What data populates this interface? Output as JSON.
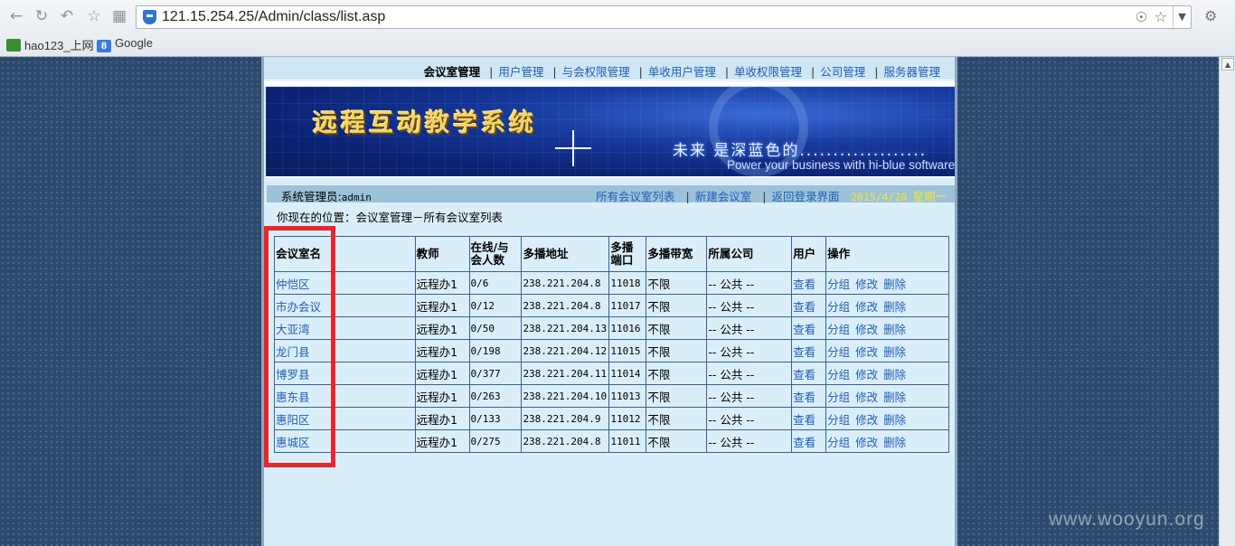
{
  "browser": {
    "url": "121.15.254.25/Admin/class/list.asp",
    "bookmarks": [
      "hao123_上网",
      "Google"
    ]
  },
  "topnav": {
    "items": [
      "会议室管理",
      "用户管理",
      "与会权限管理",
      "单收用户管理",
      "单收权限管理",
      "公司管理",
      "服务器管理"
    ]
  },
  "banner": {
    "title": "远程互动教学系统",
    "slogan_cn": "未来 是深蓝色的...................",
    "slogan_en": "Power your business with hi-blue software"
  },
  "userbar": {
    "role_label": "系统管理员:",
    "username": "admin",
    "links": [
      "所有会议室列表",
      "新建会议室",
      "返回登录界面"
    ],
    "date": "2015/4/20",
    "weekday": "星期一"
  },
  "breadcrumb": "你现在的位置：会议室管理－所有会议室列表",
  "table": {
    "headers": {
      "name": "会议室名",
      "teacher": "教师",
      "online_a": "在线/与",
      "online_b": "会人数",
      "address": "多播地址",
      "port_a": "多播",
      "port_b": "端口",
      "bandwidth": "多播带宽",
      "company": "所属公司",
      "users": "用户",
      "ops": "操作"
    },
    "rows": [
      {
        "name": "仲恺区",
        "teacher": "远程办1",
        "online": "0/6",
        "address": "238.221.204.8",
        "port": "11018",
        "bandwidth": "不限",
        "company": "-- 公共 --",
        "view": "查看",
        "group": "分组",
        "edit": "修改",
        "del": "删除"
      },
      {
        "name": "市办会议",
        "teacher": "远程办1",
        "online": "0/12",
        "address": "238.221.204.8",
        "port": "11017",
        "bandwidth": "不限",
        "company": "-- 公共 --",
        "view": "查看",
        "group": "分组",
        "edit": "修改",
        "del": "删除"
      },
      {
        "name": "大亚湾",
        "teacher": "远程办1",
        "online": "0/50",
        "address": "238.221.204.13",
        "port": "11016",
        "bandwidth": "不限",
        "company": "-- 公共 --",
        "view": "查看",
        "group": "分组",
        "edit": "修改",
        "del": "删除"
      },
      {
        "name": "龙门县",
        "teacher": "远程办1",
        "online": "0/198",
        "address": "238.221.204.12",
        "port": "11015",
        "bandwidth": "不限",
        "company": "-- 公共 --",
        "view": "查看",
        "group": "分组",
        "edit": "修改",
        "del": "删除"
      },
      {
        "name": "博罗县",
        "teacher": "远程办1",
        "online": "0/377",
        "address": "238.221.204.11",
        "port": "11014",
        "bandwidth": "不限",
        "company": "-- 公共 --",
        "view": "查看",
        "group": "分组",
        "edit": "修改",
        "del": "删除"
      },
      {
        "name": "惠东县",
        "teacher": "远程办1",
        "online": "0/263",
        "address": "238.221.204.10",
        "port": "11013",
        "bandwidth": "不限",
        "company": "-- 公共 --",
        "view": "查看",
        "group": "分组",
        "edit": "修改",
        "del": "删除"
      },
      {
        "name": "惠阳区",
        "teacher": "远程办1",
        "online": "0/133",
        "address": "238.221.204.9",
        "port": "11012",
        "bandwidth": "不限",
        "company": "-- 公共 --",
        "view": "查看",
        "group": "分组",
        "edit": "修改",
        "del": "删除"
      },
      {
        "name": "惠城区",
        "teacher": "远程办1",
        "online": "0/275",
        "address": "238.221.204.8",
        "port": "11011",
        "bandwidth": "不限",
        "company": "-- 公共 --",
        "view": "查看",
        "group": "分组",
        "edit": "修改",
        "del": "删除"
      }
    ]
  },
  "watermark": "www.wooyun.org",
  "colors": {
    "link": "#1f5fb4",
    "highlight_box": "#e8262b",
    "date_text": "#f6e82c",
    "page_bg": "#daeefa"
  }
}
